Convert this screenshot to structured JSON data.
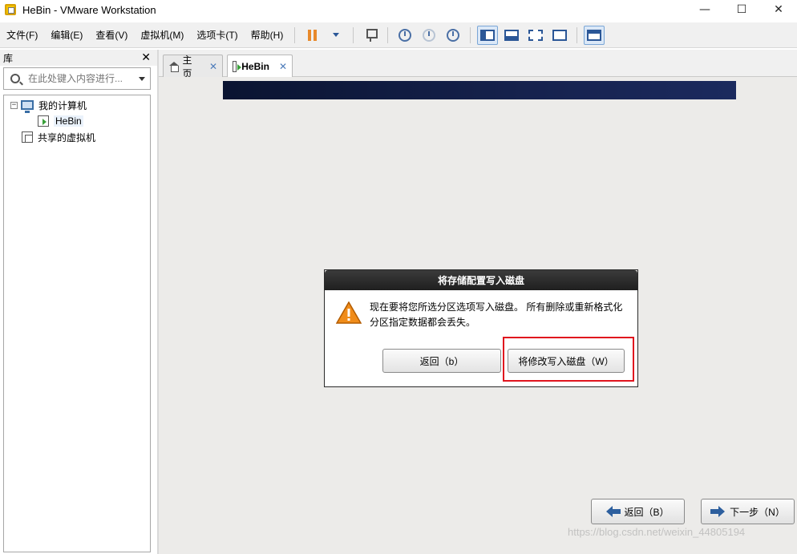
{
  "window": {
    "title": "HeBin - VMware Workstation",
    "minimize": "—",
    "maximize": "☐",
    "close": "✕"
  },
  "menu": {
    "items": [
      "文件(F)",
      "编辑(E)",
      "查看(V)",
      "虚拟机(M)",
      "选项卡(T)",
      "帮助(H)"
    ]
  },
  "toolbar": {
    "icons": [
      "pause-icon",
      "dropdown-icon",
      "network-icon",
      "snapshot-take-icon",
      "snapshot-revert-icon",
      "snapshot-manager-icon",
      "library-view-icon",
      "console-view-icon",
      "fullscreen-icon",
      "unity-icon",
      "thumbnail-view-icon"
    ],
    "accent": "#e8892b"
  },
  "library": {
    "title": "库",
    "close": "✕",
    "search_placeholder": "在此处键入内容进行...",
    "tree": {
      "root": "我的计算机",
      "root_toggle": "−",
      "vm": "HeBin",
      "shared": "共享的虚拟机"
    }
  },
  "tabs": [
    {
      "label": "主页",
      "close": "✕"
    },
    {
      "label": "HeBin",
      "close": "✕"
    }
  ],
  "dialog": {
    "title": "将存储配置写入磁盘",
    "message": "现在要将您所选分区选项写入磁盘。  所有删除或重新格式化分区指定数据都会丢失。",
    "back_button": "返回（b）",
    "write_button": "将修改写入磁盘（W）",
    "highlight_color": "#e0141e"
  },
  "installer_nav": {
    "back": "返回（B）",
    "next": "下一步（N）"
  },
  "watermark": "https://blog.csdn.net/weixin_44805194"
}
